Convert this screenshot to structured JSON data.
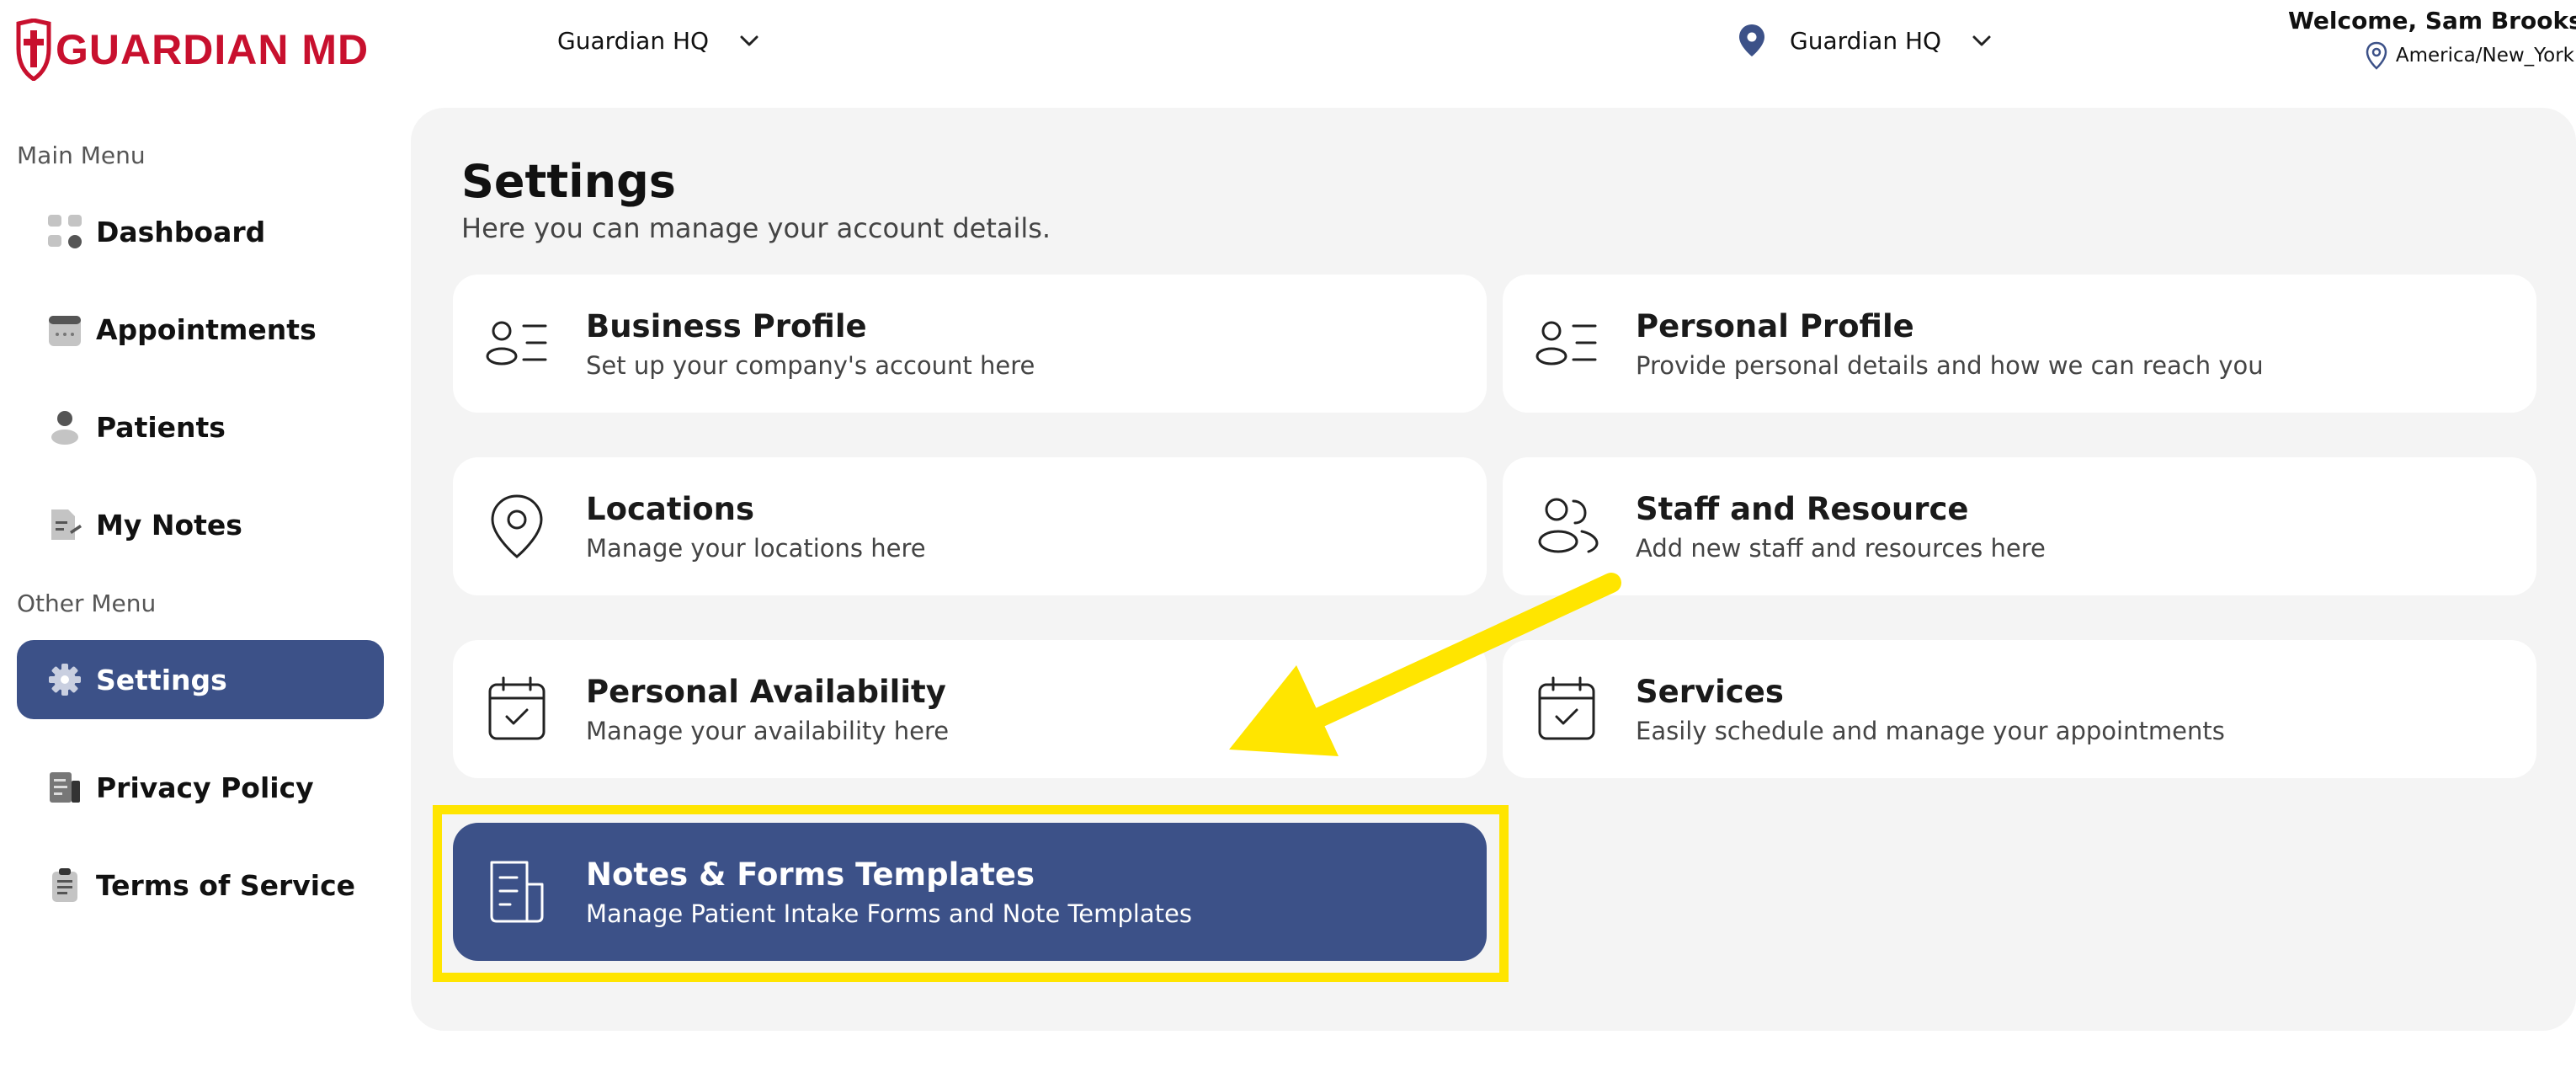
{
  "brand": {
    "name": "GUARDIAN MD",
    "color": "#c8102e"
  },
  "header": {
    "org_select": "Guardian HQ",
    "location_select": "Guardian HQ",
    "welcome": "Welcome, Sam Brooks",
    "timezone": "America/New_York"
  },
  "sidebar": {
    "main_label": "Main Menu",
    "other_label": "Other Menu",
    "main_items": [
      {
        "label": "Dashboard",
        "icon": "dashboard-icon"
      },
      {
        "label": "Appointments",
        "icon": "calendar-icon"
      },
      {
        "label": "Patients",
        "icon": "user-icon"
      },
      {
        "label": "My Notes",
        "icon": "note-edit-icon"
      }
    ],
    "other_items": [
      {
        "label": "Settings",
        "icon": "gear-icon",
        "active": true
      },
      {
        "label": "Privacy Policy",
        "icon": "document-icon"
      },
      {
        "label": "Terms of Service",
        "icon": "clipboard-icon"
      }
    ]
  },
  "main": {
    "title": "Settings",
    "subtitle": "Here you can manage your account details.",
    "cards": [
      {
        "title": "Business Profile",
        "subtitle": "Set up your company's account here",
        "icon": "profile-list-icon"
      },
      {
        "title": "Personal Profile",
        "subtitle": "Provide personal details and how we can reach you",
        "icon": "profile-list-icon"
      },
      {
        "title": "Locations",
        "subtitle": "Manage your locations here",
        "icon": "location-pin-icon"
      },
      {
        "title": "Staff and Resource",
        "subtitle": "Add new staff and resources here",
        "icon": "users-icon"
      },
      {
        "title": "Personal Availability",
        "subtitle": "Manage your availability here",
        "icon": "calendar-check-icon"
      },
      {
        "title": "Services",
        "subtitle": "Easily schedule and manage your appointments",
        "icon": "calendar-check-icon"
      },
      {
        "title": "Notes & Forms Templates",
        "subtitle": "Manage Patient Intake Forms and Note Templates",
        "icon": "document-template-icon",
        "active": true
      }
    ]
  },
  "colors": {
    "accent": "#3c5188",
    "highlight": "#ffe500",
    "panel_bg": "#f4f4f4"
  }
}
